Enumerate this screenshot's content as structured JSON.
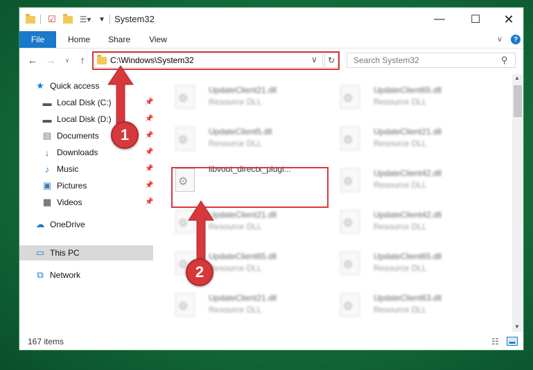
{
  "window": {
    "title": "System32"
  },
  "ribbon": {
    "tabs": [
      "File",
      "Home",
      "Share",
      "View"
    ]
  },
  "address": {
    "path": "C:\\Windows\\System32"
  },
  "search": {
    "placeholder": "Search System32"
  },
  "sidebar": {
    "quick_access": "Quick access",
    "items": [
      {
        "label": "Local Disk (C:)",
        "icon": "drive-icon"
      },
      {
        "label": "Local Disk (D:)",
        "icon": "drive-icon"
      },
      {
        "label": "Documents",
        "icon": "document-icon"
      },
      {
        "label": "Downloads",
        "icon": "download-icon"
      },
      {
        "label": "Music",
        "icon": "music-icon"
      },
      {
        "label": "Pictures",
        "icon": "picture-icon"
      },
      {
        "label": "Videos",
        "icon": "video-icon"
      }
    ],
    "onedrive": "OneDrive",
    "this_pc": "This PC",
    "network": "Network"
  },
  "files": {
    "left": [
      {
        "name": "UpdateClient21.dll",
        "type": "Resource DLL"
      },
      {
        "name": "UpdateClient5.dll",
        "type": "Resource DLL"
      },
      {
        "name": "libvout_directx_plugi...",
        "type": ""
      },
      {
        "name": "UpdateClient21.dll",
        "type": "Resource DLL"
      },
      {
        "name": "UpdateClient65.dll",
        "type": "Resource DLL"
      },
      {
        "name": "UpdateClient21.dll",
        "type": "Resource DLL"
      }
    ],
    "right": [
      {
        "name": "UpdateClient65.dll",
        "type": "Resource DLL"
      },
      {
        "name": "UpdateClient21.dll",
        "type": "Resource DLL"
      },
      {
        "name": "UpdateClient42.dll",
        "type": "Resource DLL"
      },
      {
        "name": "UpdateClient42.dll",
        "type": "Resource DLL"
      },
      {
        "name": "UpdateClient65.dll",
        "type": "Resource DLL"
      },
      {
        "name": "UpdateClient63.dll",
        "type": "Resource DLL"
      }
    ]
  },
  "status": {
    "count": "167 items"
  },
  "callouts": [
    "1",
    "2"
  ],
  "colors": {
    "accent": "#1979ca",
    "highlight": "#d6383c",
    "background": "#136c3a"
  }
}
